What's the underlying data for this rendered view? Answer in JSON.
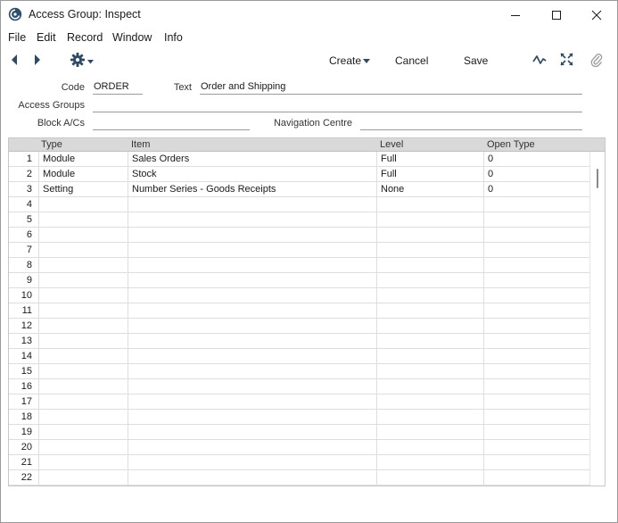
{
  "window": {
    "title": "Access Group: Inspect"
  },
  "menu": {
    "items": [
      "File",
      "Edit",
      "Record",
      "Window",
      "Info"
    ]
  },
  "toolbar": {
    "create_label": "Create",
    "cancel_label": "Cancel",
    "save_label": "Save"
  },
  "form": {
    "code_label": "Code",
    "code_value": "ORDER",
    "text_label": "Text",
    "text_value": "Order and Shipping",
    "access_groups_label": "Access Groups",
    "access_groups_value": "",
    "block_acs_label": "Block A/Cs",
    "block_acs_value": "",
    "nav_centre_label": "Navigation Centre",
    "nav_centre_value": ""
  },
  "grid": {
    "columns": [
      "Type",
      "Item",
      "Level",
      "Open Type"
    ],
    "rows": [
      {
        "num": "1",
        "type": "Module",
        "item": "Sales Orders",
        "level": "Full",
        "open_type": "0"
      },
      {
        "num": "2",
        "type": "Module",
        "item": "Stock",
        "level": "Full",
        "open_type": "0"
      },
      {
        "num": "3",
        "type": "Setting",
        "item": "Number Series - Goods Receipts",
        "level": "None",
        "open_type": "0"
      },
      {
        "num": "4",
        "type": "",
        "item": "",
        "level": "",
        "open_type": ""
      },
      {
        "num": "5",
        "type": "",
        "item": "",
        "level": "",
        "open_type": ""
      },
      {
        "num": "6",
        "type": "",
        "item": "",
        "level": "",
        "open_type": ""
      },
      {
        "num": "7",
        "type": "",
        "item": "",
        "level": "",
        "open_type": ""
      },
      {
        "num": "8",
        "type": "",
        "item": "",
        "level": "",
        "open_type": ""
      },
      {
        "num": "9",
        "type": "",
        "item": "",
        "level": "",
        "open_type": ""
      },
      {
        "num": "10",
        "type": "",
        "item": "",
        "level": "",
        "open_type": ""
      },
      {
        "num": "11",
        "type": "",
        "item": "",
        "level": "",
        "open_type": ""
      },
      {
        "num": "12",
        "type": "",
        "item": "",
        "level": "",
        "open_type": ""
      },
      {
        "num": "13",
        "type": "",
        "item": "",
        "level": "",
        "open_type": ""
      },
      {
        "num": "14",
        "type": "",
        "item": "",
        "level": "",
        "open_type": ""
      },
      {
        "num": "15",
        "type": "",
        "item": "",
        "level": "",
        "open_type": ""
      },
      {
        "num": "16",
        "type": "",
        "item": "",
        "level": "",
        "open_type": ""
      },
      {
        "num": "17",
        "type": "",
        "item": "",
        "level": "",
        "open_type": ""
      },
      {
        "num": "18",
        "type": "",
        "item": "",
        "level": "",
        "open_type": ""
      },
      {
        "num": "19",
        "type": "",
        "item": "",
        "level": "",
        "open_type": ""
      },
      {
        "num": "20",
        "type": "",
        "item": "",
        "level": "",
        "open_type": ""
      },
      {
        "num": "21",
        "type": "",
        "item": "",
        "level": "",
        "open_type": ""
      },
      {
        "num": "22",
        "type": "",
        "item": "",
        "level": "",
        "open_type": ""
      }
    ]
  },
  "icons": {
    "app": "app-logo-icon",
    "minimize": "minimize-icon",
    "maximize": "maximize-icon",
    "close": "close-icon",
    "back": "arrow-left-icon",
    "forward": "arrow-right-icon",
    "settings": "gear-icon",
    "activity": "activity-icon",
    "fullscreen": "expand-icon",
    "attach": "paperclip-icon"
  }
}
